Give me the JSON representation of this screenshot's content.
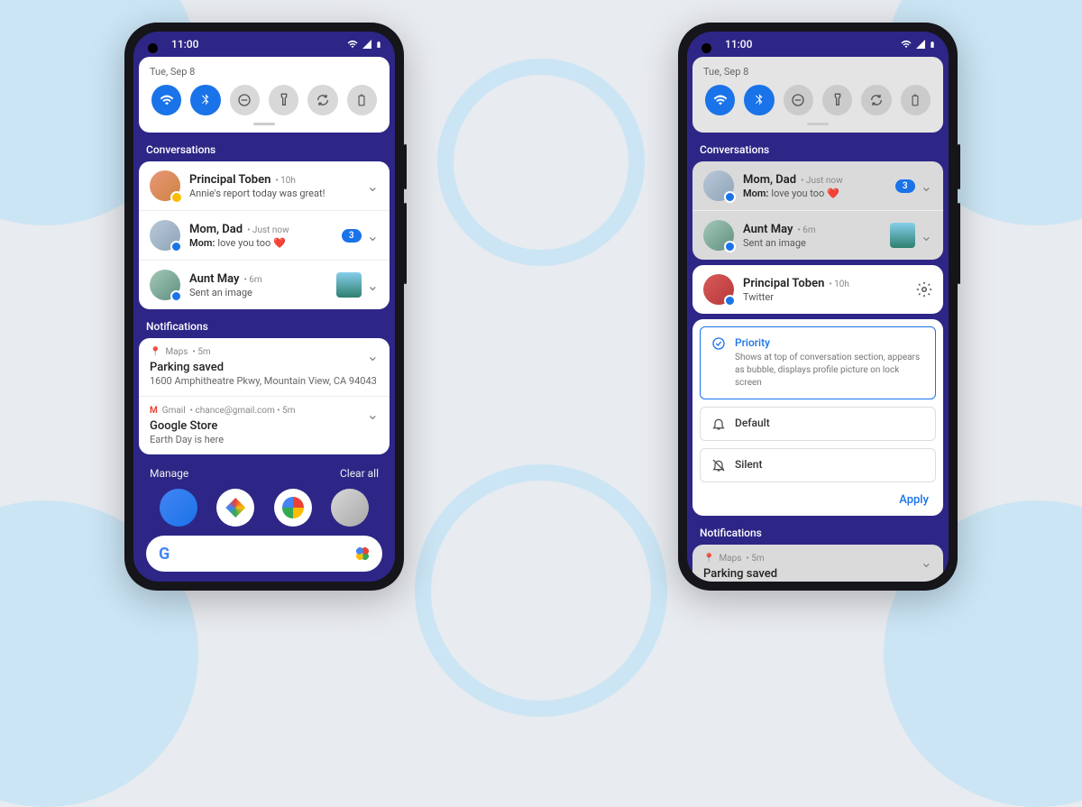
{
  "status": {
    "time": "11:00"
  },
  "qs": {
    "date": "Tue, Sep 8"
  },
  "sections": {
    "conversations": "Conversations",
    "notifications": "Notifications"
  },
  "left": {
    "conv": [
      {
        "name": "Principal Toben",
        "time": "• 10h",
        "msg": "Annie's report today was great!"
      },
      {
        "name": "Mom, Dad",
        "time": "• Just now",
        "from": "Mom:",
        "msg": "love you too",
        "count": "3"
      },
      {
        "name": "Aunt May",
        "time": "• 6m",
        "msg": "Sent an image"
      }
    ],
    "notif": [
      {
        "app": "Maps",
        "time": "• 5m",
        "title": "Parking saved",
        "sub": "1600 Amphitheatre Pkwy, Mountain View, CA 94043"
      },
      {
        "app": "Gmail",
        "meta": "• chance@gmail.com • 5m",
        "title": "Google Store",
        "sub": "Earth Day is here"
      }
    ],
    "footer": {
      "manage": "Manage",
      "clear": "Clear all"
    }
  },
  "right": {
    "conv": [
      {
        "name": "Mom, Dad",
        "time": "• Just now",
        "from": "Mom:",
        "msg": "love you too",
        "count": "3"
      },
      {
        "name": "Aunt May",
        "time": "• 6m",
        "msg": "Sent an image"
      },
      {
        "name": "Principal Toben",
        "time": "• 10h",
        "sub": "Twitter"
      }
    ],
    "opts": {
      "priority": {
        "title": "Priority",
        "desc": "Shows at top of conversation section, appears as bubble, displays profile picture on lock screen"
      },
      "default": {
        "title": "Default"
      },
      "silent": {
        "title": "Silent"
      },
      "apply": "Apply"
    },
    "notif": {
      "app": "Maps",
      "time": "• 5m",
      "title": "Parking saved"
    }
  }
}
